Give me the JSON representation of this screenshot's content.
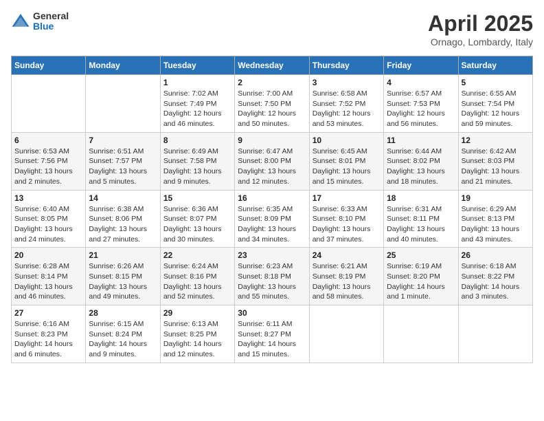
{
  "header": {
    "logo_general": "General",
    "logo_blue": "Blue",
    "title": "April 2025",
    "subtitle": "Ornago, Lombardy, Italy"
  },
  "days_of_week": [
    "Sunday",
    "Monday",
    "Tuesday",
    "Wednesday",
    "Thursday",
    "Friday",
    "Saturday"
  ],
  "weeks": [
    [
      {
        "num": "",
        "detail": ""
      },
      {
        "num": "",
        "detail": ""
      },
      {
        "num": "1",
        "detail": "Sunrise: 7:02 AM\nSunset: 7:49 PM\nDaylight: 12 hours and 46 minutes."
      },
      {
        "num": "2",
        "detail": "Sunrise: 7:00 AM\nSunset: 7:50 PM\nDaylight: 12 hours and 50 minutes."
      },
      {
        "num": "3",
        "detail": "Sunrise: 6:58 AM\nSunset: 7:52 PM\nDaylight: 12 hours and 53 minutes."
      },
      {
        "num": "4",
        "detail": "Sunrise: 6:57 AM\nSunset: 7:53 PM\nDaylight: 12 hours and 56 minutes."
      },
      {
        "num": "5",
        "detail": "Sunrise: 6:55 AM\nSunset: 7:54 PM\nDaylight: 12 hours and 59 minutes."
      }
    ],
    [
      {
        "num": "6",
        "detail": "Sunrise: 6:53 AM\nSunset: 7:56 PM\nDaylight: 13 hours and 2 minutes."
      },
      {
        "num": "7",
        "detail": "Sunrise: 6:51 AM\nSunset: 7:57 PM\nDaylight: 13 hours and 5 minutes."
      },
      {
        "num": "8",
        "detail": "Sunrise: 6:49 AM\nSunset: 7:58 PM\nDaylight: 13 hours and 9 minutes."
      },
      {
        "num": "9",
        "detail": "Sunrise: 6:47 AM\nSunset: 8:00 PM\nDaylight: 13 hours and 12 minutes."
      },
      {
        "num": "10",
        "detail": "Sunrise: 6:45 AM\nSunset: 8:01 PM\nDaylight: 13 hours and 15 minutes."
      },
      {
        "num": "11",
        "detail": "Sunrise: 6:44 AM\nSunset: 8:02 PM\nDaylight: 13 hours and 18 minutes."
      },
      {
        "num": "12",
        "detail": "Sunrise: 6:42 AM\nSunset: 8:03 PM\nDaylight: 13 hours and 21 minutes."
      }
    ],
    [
      {
        "num": "13",
        "detail": "Sunrise: 6:40 AM\nSunset: 8:05 PM\nDaylight: 13 hours and 24 minutes."
      },
      {
        "num": "14",
        "detail": "Sunrise: 6:38 AM\nSunset: 8:06 PM\nDaylight: 13 hours and 27 minutes."
      },
      {
        "num": "15",
        "detail": "Sunrise: 6:36 AM\nSunset: 8:07 PM\nDaylight: 13 hours and 30 minutes."
      },
      {
        "num": "16",
        "detail": "Sunrise: 6:35 AM\nSunset: 8:09 PM\nDaylight: 13 hours and 34 minutes."
      },
      {
        "num": "17",
        "detail": "Sunrise: 6:33 AM\nSunset: 8:10 PM\nDaylight: 13 hours and 37 minutes."
      },
      {
        "num": "18",
        "detail": "Sunrise: 6:31 AM\nSunset: 8:11 PM\nDaylight: 13 hours and 40 minutes."
      },
      {
        "num": "19",
        "detail": "Sunrise: 6:29 AM\nSunset: 8:13 PM\nDaylight: 13 hours and 43 minutes."
      }
    ],
    [
      {
        "num": "20",
        "detail": "Sunrise: 6:28 AM\nSunset: 8:14 PM\nDaylight: 13 hours and 46 minutes."
      },
      {
        "num": "21",
        "detail": "Sunrise: 6:26 AM\nSunset: 8:15 PM\nDaylight: 13 hours and 49 minutes."
      },
      {
        "num": "22",
        "detail": "Sunrise: 6:24 AM\nSunset: 8:16 PM\nDaylight: 13 hours and 52 minutes."
      },
      {
        "num": "23",
        "detail": "Sunrise: 6:23 AM\nSunset: 8:18 PM\nDaylight: 13 hours and 55 minutes."
      },
      {
        "num": "24",
        "detail": "Sunrise: 6:21 AM\nSunset: 8:19 PM\nDaylight: 13 hours and 58 minutes."
      },
      {
        "num": "25",
        "detail": "Sunrise: 6:19 AM\nSunset: 8:20 PM\nDaylight: 14 hours and 1 minute."
      },
      {
        "num": "26",
        "detail": "Sunrise: 6:18 AM\nSunset: 8:22 PM\nDaylight: 14 hours and 3 minutes."
      }
    ],
    [
      {
        "num": "27",
        "detail": "Sunrise: 6:16 AM\nSunset: 8:23 PM\nDaylight: 14 hours and 6 minutes."
      },
      {
        "num": "28",
        "detail": "Sunrise: 6:15 AM\nSunset: 8:24 PM\nDaylight: 14 hours and 9 minutes."
      },
      {
        "num": "29",
        "detail": "Sunrise: 6:13 AM\nSunset: 8:25 PM\nDaylight: 14 hours and 12 minutes."
      },
      {
        "num": "30",
        "detail": "Sunrise: 6:11 AM\nSunset: 8:27 PM\nDaylight: 14 hours and 15 minutes."
      },
      {
        "num": "",
        "detail": ""
      },
      {
        "num": "",
        "detail": ""
      },
      {
        "num": "",
        "detail": ""
      }
    ]
  ]
}
